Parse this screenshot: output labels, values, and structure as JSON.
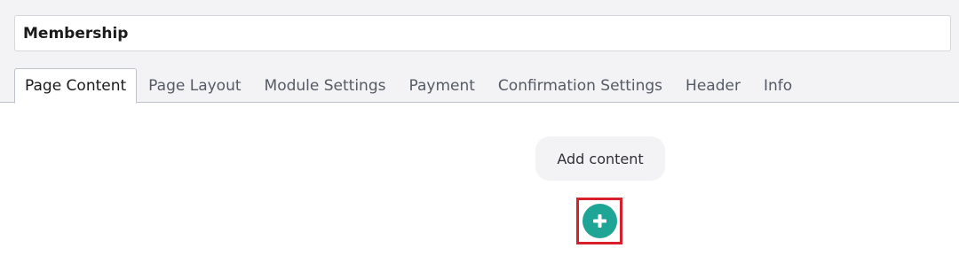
{
  "page": {
    "title_value": "Membership"
  },
  "tabs": [
    {
      "label": "Page Content",
      "active": true
    },
    {
      "label": "Page Layout",
      "active": false
    },
    {
      "label": "Module Settings",
      "active": false
    },
    {
      "label": "Payment",
      "active": false
    },
    {
      "label": "Confirmation Settings",
      "active": false
    },
    {
      "label": "Header",
      "active": false
    },
    {
      "label": "Info",
      "active": false
    }
  ],
  "content": {
    "add_content_label": "Add content",
    "add_button_icon": "plus-icon"
  },
  "colors": {
    "accent": "#1ea596",
    "highlight": "#d8202c",
    "toolbar_bg": "#f3f3f5"
  }
}
